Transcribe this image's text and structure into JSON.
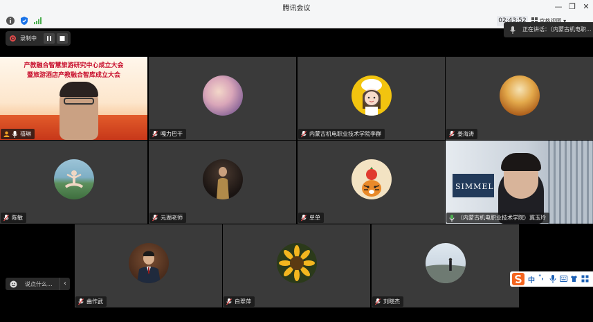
{
  "window": {
    "title": "腾讯会议"
  },
  "toolbar": {
    "clock": "02:43:52",
    "view_label": "宫格视图"
  },
  "recording": {
    "label": "录制中"
  },
  "speaking": {
    "label": "正在讲话：（内蒙古机电职..."
  },
  "chat": {
    "placeholder": "说点什么..."
  },
  "ime": {
    "lang": "中",
    "punct": "°,"
  },
  "colors": {
    "accent": "#1a73e8",
    "record": "#e24a4a",
    "tile": "#3a3a3a",
    "mic_on": "#4caf50"
  },
  "participants": [
    {
      "name": "禧琳",
      "banner_line1": "产教融合智慧旅游研究中心成立大会",
      "banner_line2": "暨旅游酒店产教融合智库成立大会"
    },
    {
      "name": "嘎力巴干"
    },
    {
      "name": "内蒙古机电职业技术学院李群"
    },
    {
      "name": "姜海涛"
    },
    {
      "name": "陈敏"
    },
    {
      "name": "元瑚老师"
    },
    {
      "name": "单单"
    },
    {
      "name": "（内蒙古机电职业技术学院）冀玉玲",
      "backdrop_text": "SIMMEL"
    },
    {
      "name": "曲作武"
    },
    {
      "name": "白翠萍"
    },
    {
      "name": "刘晓杰"
    }
  ]
}
